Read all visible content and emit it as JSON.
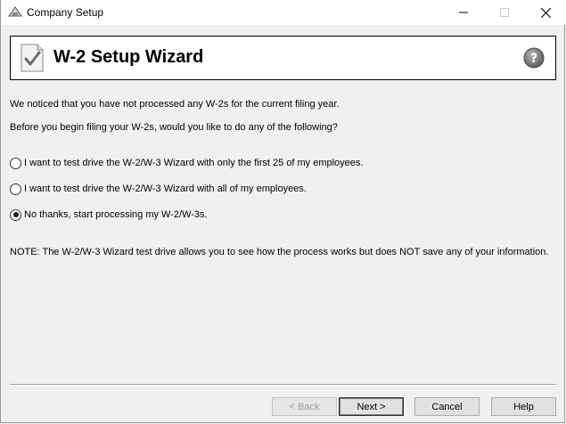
{
  "window": {
    "title": "Company Setup",
    "minimize_icon": "minimize-icon",
    "maximize_icon": "maximize-icon",
    "close_icon": "close-icon"
  },
  "banner": {
    "title": "W-2 Setup Wizard",
    "icon": "document-check-icon",
    "help_icon": "help-icon"
  },
  "content": {
    "intro_line_1": "We noticed that you have not processed any W-2s for the current filing year.",
    "intro_line_2": "Before you begin filing your W-2s, would you like to do any of the following?",
    "options": [
      {
        "label": "I want to test drive the W-2/W-3 Wizard with only the first 25 of my employees.",
        "selected": false
      },
      {
        "label": "I want to test drive the W-2/W-3 Wizard with all of my employees.",
        "selected": false
      },
      {
        "label": "No thanks, start processing my W-2/W-3s.",
        "selected": true
      }
    ],
    "note": "NOTE: The W-2/W-3 Wizard test drive allows you to see how the process works but does NOT save any of your information."
  },
  "buttons": {
    "back": "< Back",
    "next": "Next >",
    "cancel": "Cancel",
    "help": "Help"
  }
}
